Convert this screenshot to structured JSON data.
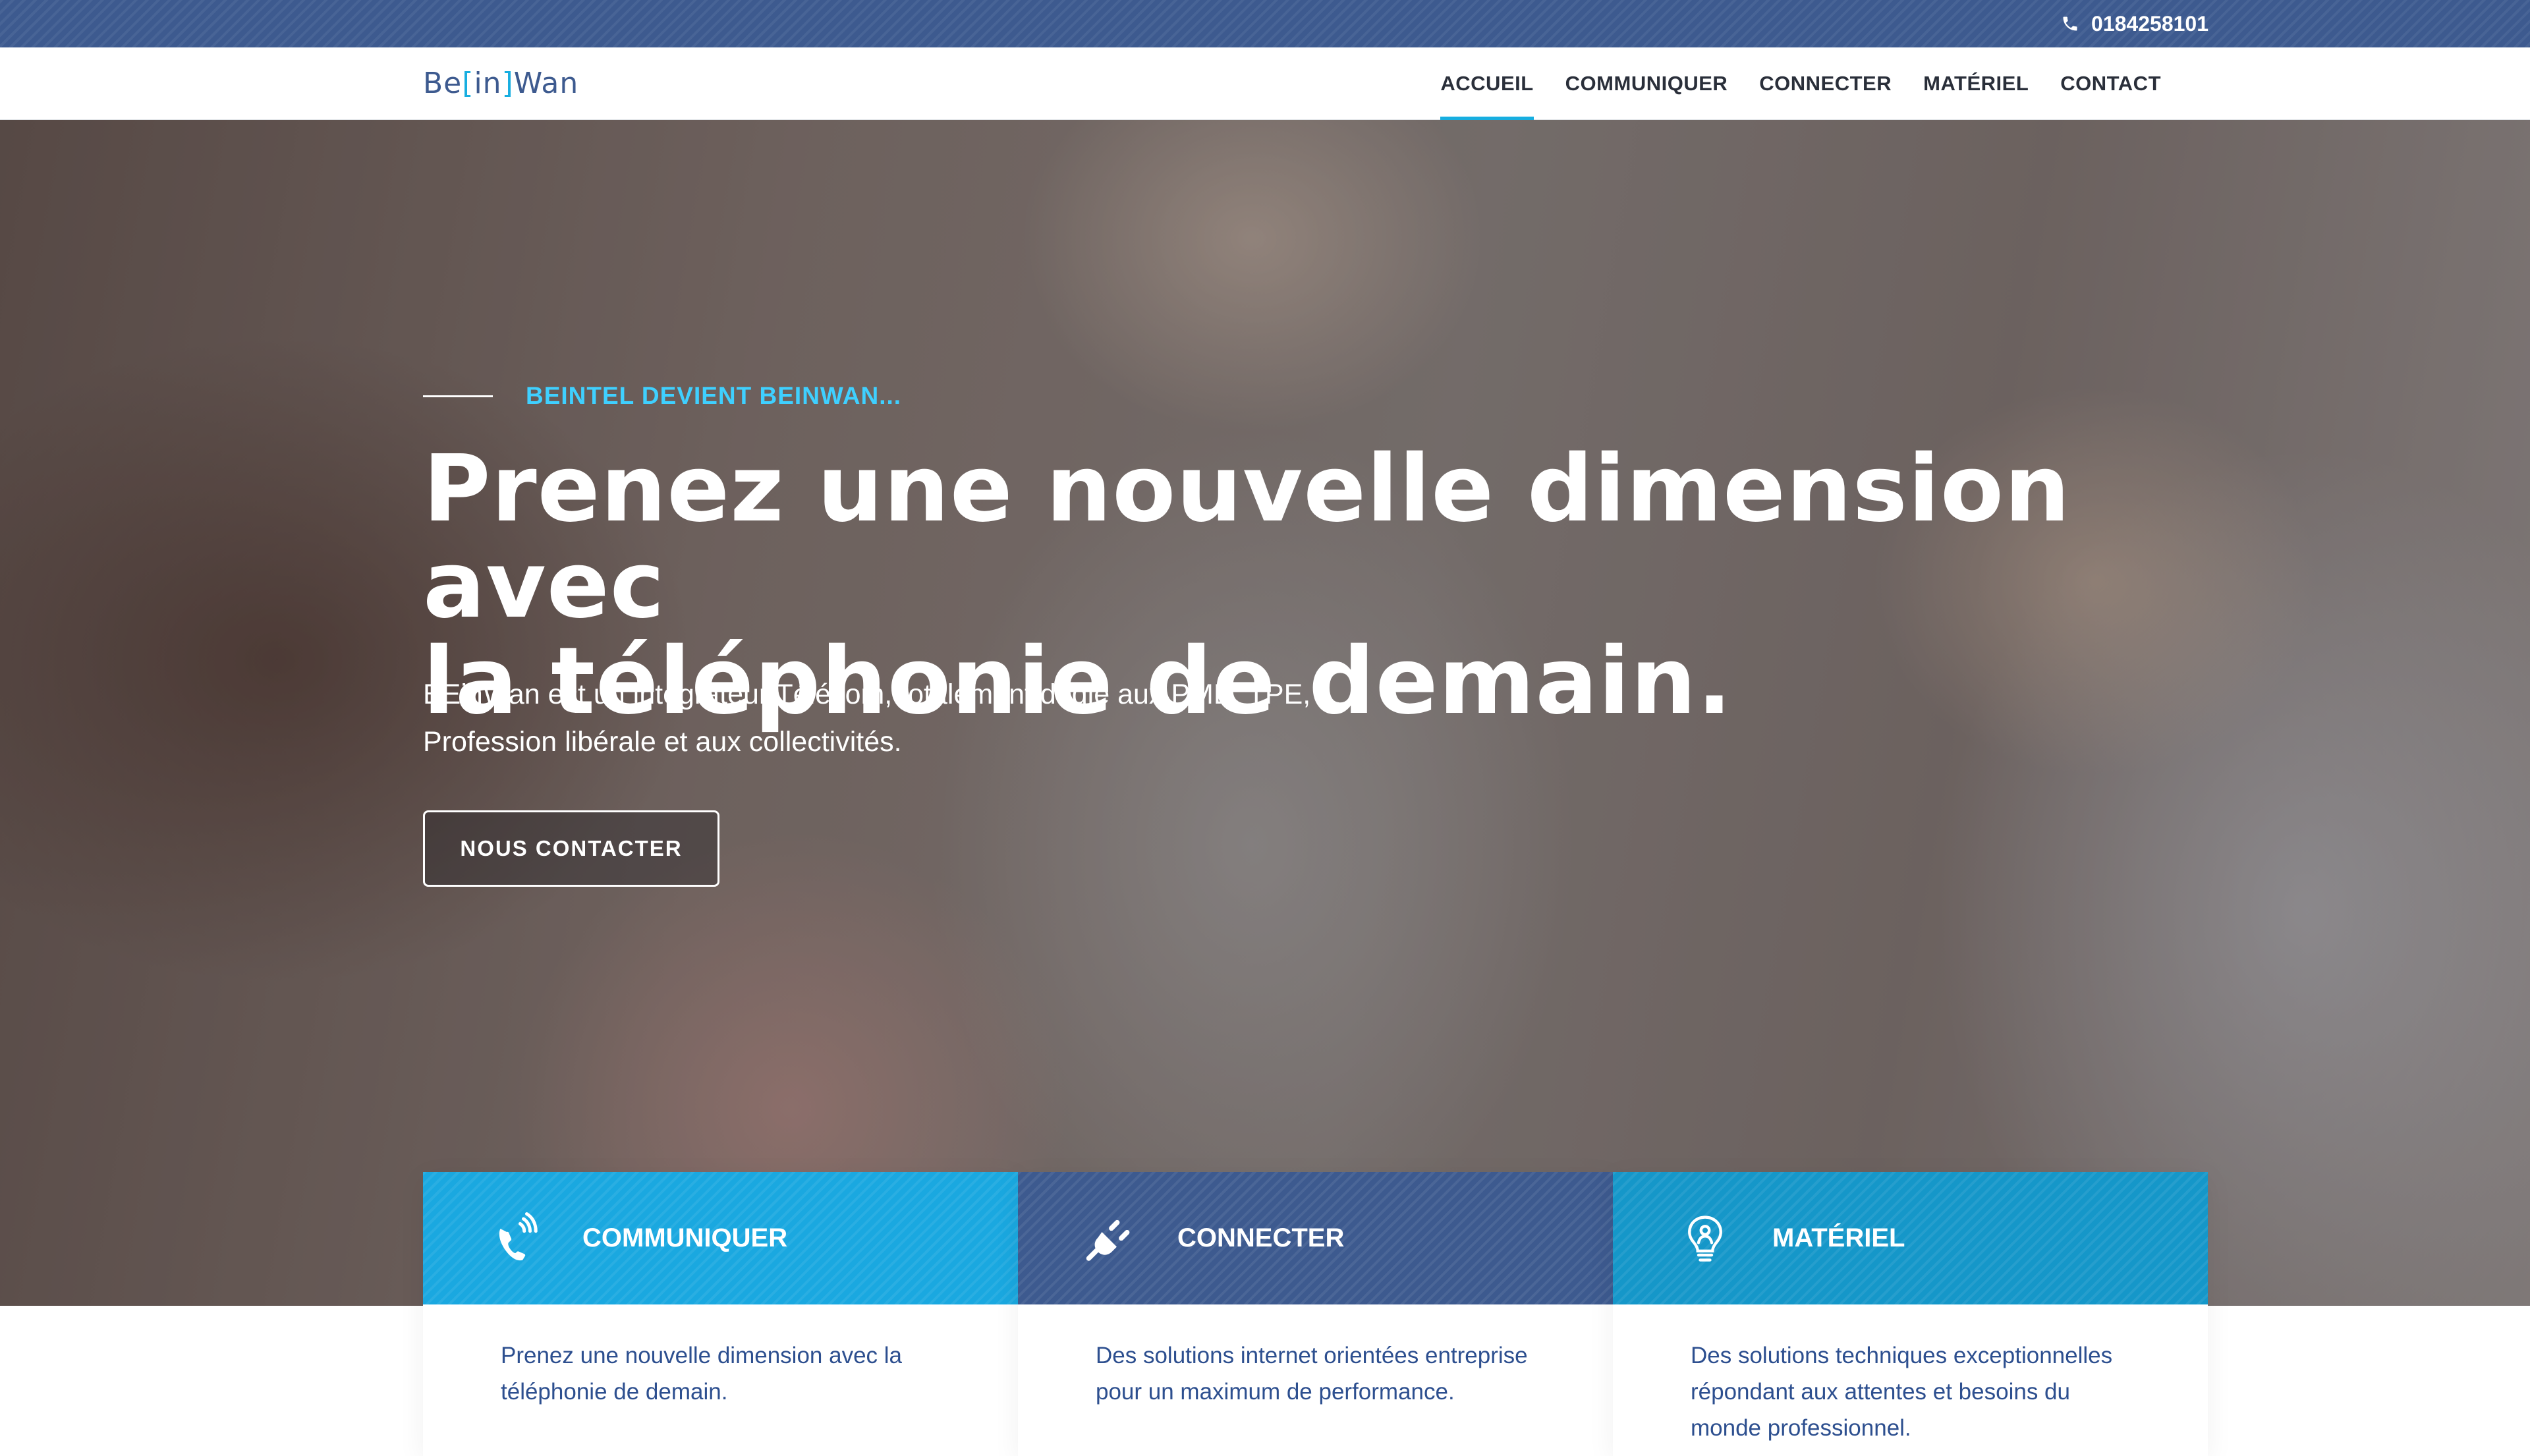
{
  "topbar": {
    "phone_icon": "phone-icon",
    "phone_number": "0184258101"
  },
  "header": {
    "logo_prefix": "Be",
    "logo_bracket_open": "[",
    "logo_in": "in",
    "logo_bracket_close": "]",
    "logo_suffix": "Wan",
    "nav": [
      {
        "label": "ACCUEIL",
        "active": true
      },
      {
        "label": "COMMUNIQUER",
        "active": false
      },
      {
        "label": "CONNECTER",
        "active": false
      },
      {
        "label": "MATÉRIEL",
        "active": false
      },
      {
        "label": "CONTACT",
        "active": false
      }
    ]
  },
  "hero": {
    "eyebrow": "BEINTEL DEVIENT BEINWAN...",
    "headline_line1": "Prenez une nouvelle dimension avec",
    "headline_line2": "la téléphonie de demain.",
    "subtext_line1": "BEinWan est un intégrateur Télécom, totalement dédié aux PME, TPE,",
    "subtext_line2": "Profession libérale et aux collectivités.",
    "cta_label": "NOUS CONTACTER"
  },
  "cards": [
    {
      "icon": "phone-waves-icon",
      "title": "COMMUNIQUER",
      "color": "#1aa8e0",
      "description": "Prenez une nouvelle dimension avec la téléphonie de demain."
    },
    {
      "icon": "plug-icon",
      "title": "CONNECTER",
      "color": "#3d5a8f",
      "description": "Des solutions internet orientées entreprise pour un maximum de performance."
    },
    {
      "icon": "lightbulb-icon",
      "title": "MATÉRIEL",
      "color": "#1597c9",
      "description": "Des solutions techniques exceptionnelles répondant aux attentes et besoins du monde professionnel."
    }
  ],
  "colors": {
    "topbar": "#3d5a8f",
    "accent": "#17aee0",
    "eyebrow": "#3fd0ff",
    "card_text": "#2d4f8f"
  }
}
